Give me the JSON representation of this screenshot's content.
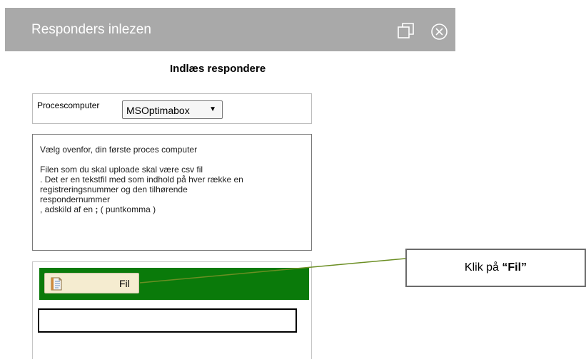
{
  "window": {
    "title": "Responders inlezen",
    "restore_icon": "restore-window-icon",
    "close_icon": "close-circle-icon",
    "titlebar_color": "#a9a9a9"
  },
  "page": {
    "heading": "Indlæs respondere"
  },
  "proc": {
    "label": "Procescomputer",
    "selected": "MSOptimabox"
  },
  "info": {
    "line1": "Vælg ovenfor, din første proces computer",
    "line2": "Filen som du skal uploade skal være csv fil",
    "line3": ". Det er en tekstfil med som indhold på hver række en",
    "line4": "registreringsnummer og den tilhørende",
    "line5": "respondernummer",
    "line6_pre": ", adskild af en ",
    "line6_bold": ";",
    "line6_post": " ( puntkomma )"
  },
  "upload": {
    "button_label": "Fil",
    "button_icon": "notepad-icon",
    "bar_color": "#0a7a0a",
    "file_value": ""
  },
  "callout": {
    "text_pre": "Klik på ",
    "text_bold": "“Fil”"
  }
}
